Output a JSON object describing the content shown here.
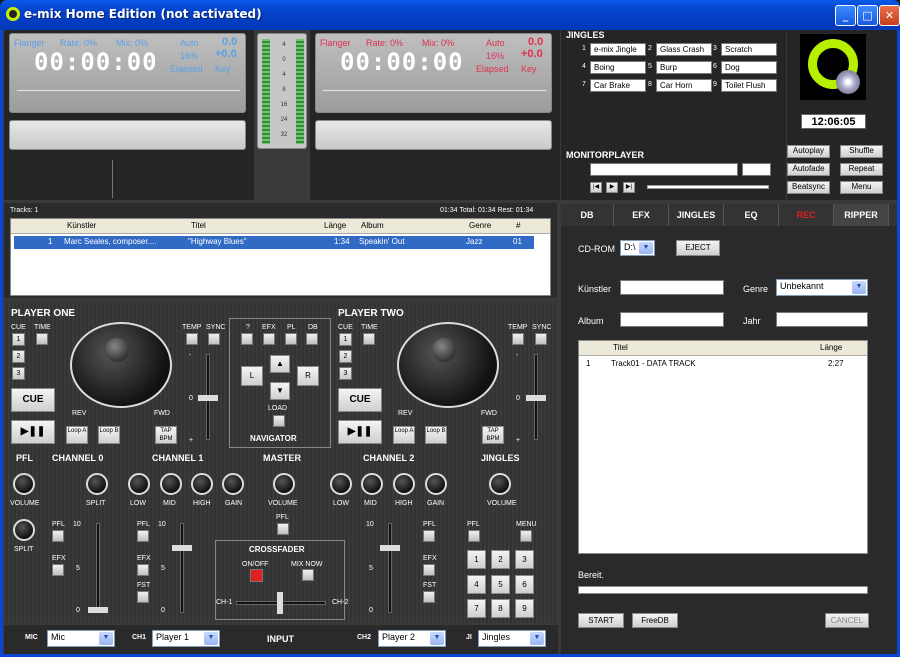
{
  "window": {
    "title": "e-mix Home Edition (not activated)",
    "min": "_",
    "max": "□",
    "close": "✕"
  },
  "deck1": {
    "flanger": "Flanger",
    "rate": "Rate: 0%",
    "mix": "Mix: 0%",
    "auto": "Auto",
    "autoval": "0.0",
    "pct": "16%",
    "pctval": "+0.0",
    "elapsed": "Elapsed",
    "key": "Key",
    "time": "00:00:00"
  },
  "deck2": {
    "flanger": "Flanger",
    "rate": "Rate: 0%",
    "mix": "Mix: 0%",
    "auto": "Auto",
    "autoval": "0.0",
    "pct": "16%",
    "pctval": "+0.0",
    "elapsed": "Elapsed",
    "key": "Key",
    "time": "00:00:00"
  },
  "vu": {
    "ticks": [
      "4",
      "0",
      "4",
      "8",
      "16",
      "24",
      "32"
    ]
  },
  "jingles": {
    "title": "JINGLES",
    "items": [
      {
        "n": "1",
        "label": "e-mix Jingle"
      },
      {
        "n": "2",
        "label": "Glass Crash"
      },
      {
        "n": "3",
        "label": "Scratch"
      },
      {
        "n": "4",
        "label": "Boing"
      },
      {
        "n": "5",
        "label": "Burp"
      },
      {
        "n": "6",
        "label": "Dog"
      },
      {
        "n": "7",
        "label": "Car Brake"
      },
      {
        "n": "8",
        "label": "Car Horn"
      },
      {
        "n": "9",
        "label": "Toilet Flush"
      }
    ]
  },
  "clock": "12:06:05",
  "monitor": {
    "title": "MONITORPLAYER"
  },
  "controls": {
    "autoplay": "Autoplay",
    "shuffle": "Shuffle",
    "autofade": "Autofade",
    "repeat": "Repeat",
    "beatsync": "Beatsync",
    "menu": "Menu"
  },
  "playlist": {
    "tracks": "Tracks: 1",
    "totals": "01:34  Total: 01:34  Rest: 01:34",
    "headers": [
      "Künstler",
      "Titel",
      "Länge",
      "Album",
      "Genre",
      "#"
    ],
    "rows": [
      {
        "idx": "1",
        "artist": "Marc Seales, composer....",
        "title": "\"Highway Blues\"",
        "len": "1:34",
        "album": "Speakin' Out",
        "genre": "Jazz",
        "num": "01"
      }
    ]
  },
  "tabs": [
    "DB",
    "EFX",
    "JINGLES",
    "EQ",
    "REC",
    "RIPPER"
  ],
  "ripper": {
    "cdrom_label": "CD-ROM",
    "drive": "D:\\",
    "eject": "EJECT",
    "kuenstler": "Künstler",
    "genre_label": "Genre",
    "genre": "Unbekannt",
    "album": "Album",
    "jahr": "Jahr",
    "col_titel": "Titel",
    "col_laenge": "Länge",
    "track_n": "1",
    "track_title": "Track01 - DATA TRACK",
    "track_len": "2:27",
    "status": "Bereit.",
    "start": "START",
    "freedb": "FreeDB",
    "cancel": "CANCEL"
  },
  "p1": {
    "title": "PLAYER ONE",
    "cue": "CUE",
    "time": "TIME",
    "n1": "1",
    "n2": "2",
    "n3": "3",
    "temp": "TEMP",
    "sync": "SYNC",
    "rev": "REV",
    "fwd": "FWD",
    "cuebtn": "CUE",
    "play": "▶❚❚",
    "loopa": "Loop A",
    "loopb": "Loop B",
    "tap": "TAP BPM",
    "minus": "-",
    "zero": "0",
    "plus": "+"
  },
  "p2": {
    "title": "PLAYER TWO",
    "cue": "CUE",
    "time": "TIME",
    "n1": "1",
    "n2": "2",
    "n3": "3",
    "temp": "TEMP",
    "sync": "SYNC",
    "rev": "REV",
    "fwd": "FWD",
    "cuebtn": "CUE",
    "play": "▶❚❚",
    "loopa": "Loop A",
    "loopb": "Loop B",
    "tap": "TAP BPM",
    "minus": "-",
    "zero": "0",
    "plus": "+"
  },
  "nav": {
    "q": "?",
    "efx": "EFX",
    "pl": "PL",
    "db": "DB",
    "l": "L",
    "r": "R",
    "load": "LOAD",
    "title": "NAVIGATOR"
  },
  "mixer": {
    "pfl": "PFL",
    "volume": "VOLUME",
    "split": "SPLIT",
    "ch0": "CHANNEL 0",
    "ch1": "CHANNEL 1",
    "master": "MASTER",
    "ch2": "CHANNEL 2",
    "jingles": "JINGLES",
    "low": "LOW",
    "mid": "MID",
    "high": "HIGH",
    "gain": "GAIN",
    "efx": "EFX",
    "fst": "FST",
    "menu": "MENU",
    "crossfader": "CROSSFADER",
    "onoff": "ON/OFF",
    "mixnow": "MIX NOW",
    "cha": "CH-1",
    "chb": "CH-2",
    "ten": "10",
    "five": "5",
    "zero": "0",
    "pads": [
      "1",
      "2",
      "3",
      "4",
      "5",
      "6",
      "7",
      "8",
      "9"
    ]
  },
  "input": {
    "mic": "MIC",
    "micval": "Mic",
    "ch1": "CH1",
    "ch1val": "Player 1",
    "title": "INPUT",
    "ch2": "CH2",
    "ch2val": "Player 2",
    "ji": "JI",
    "jival": "Jingles"
  }
}
